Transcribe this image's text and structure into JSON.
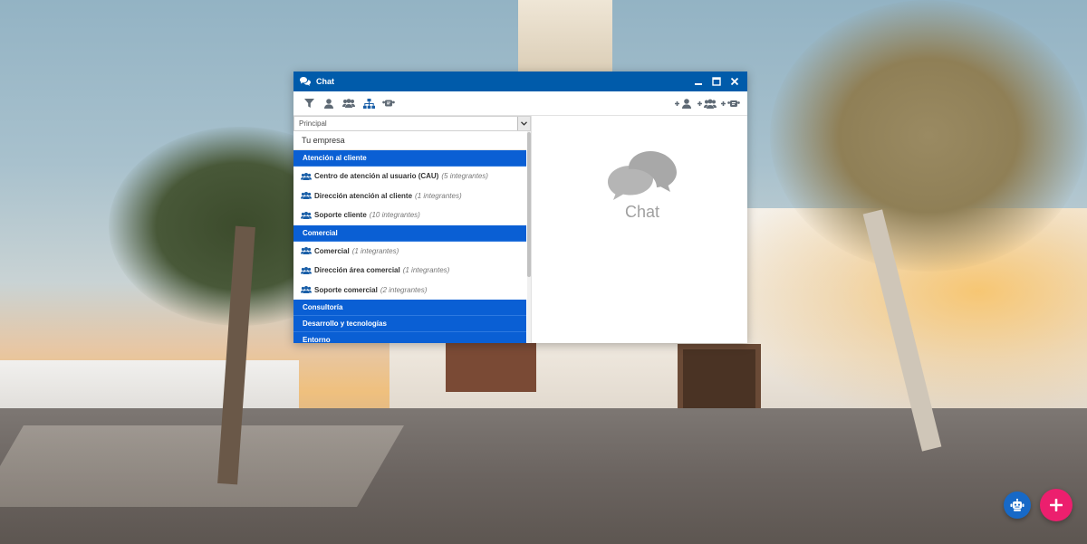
{
  "window": {
    "title": "Chat"
  },
  "toolbar": {
    "left_icons": [
      "filter-icon",
      "user-icon",
      "users-icon",
      "org-chart-icon",
      "group-chat-icon"
    ],
    "right_icons": [
      "add-user-icon",
      "add-users-icon",
      "add-group-icon"
    ]
  },
  "selector": {
    "value": "Principal"
  },
  "directory": {
    "company": "Tu empresa",
    "sections": [
      {
        "label": "Atención al cliente",
        "teams": [
          {
            "name": "Centro de atención al usuario (CAU)",
            "count": "(5 integrantes)"
          },
          {
            "name": "Dirección atención al cliente",
            "count": "(1 integrantes)"
          },
          {
            "name": "Soporte cliente",
            "count": "(10 integrantes)"
          }
        ]
      },
      {
        "label": "Comercial",
        "teams": [
          {
            "name": "Comercial",
            "count": "(1 integrantes)"
          },
          {
            "name": "Dirección área comercial",
            "count": "(1 integrantes)"
          },
          {
            "name": "Soporte comercial",
            "count": "(2 integrantes)"
          }
        ]
      },
      {
        "label": "Consultoría",
        "teams": []
      },
      {
        "label": "Desarrollo y tecnologías",
        "teams": []
      },
      {
        "label": "Entorno",
        "teams": []
      }
    ]
  },
  "placeholder": {
    "text": "Chat"
  },
  "colors": {
    "titlebar": "#005baa",
    "group_header": "#0a5fd4",
    "fab_add": "#ec1f6e",
    "fab_bot": "#1769c7"
  }
}
